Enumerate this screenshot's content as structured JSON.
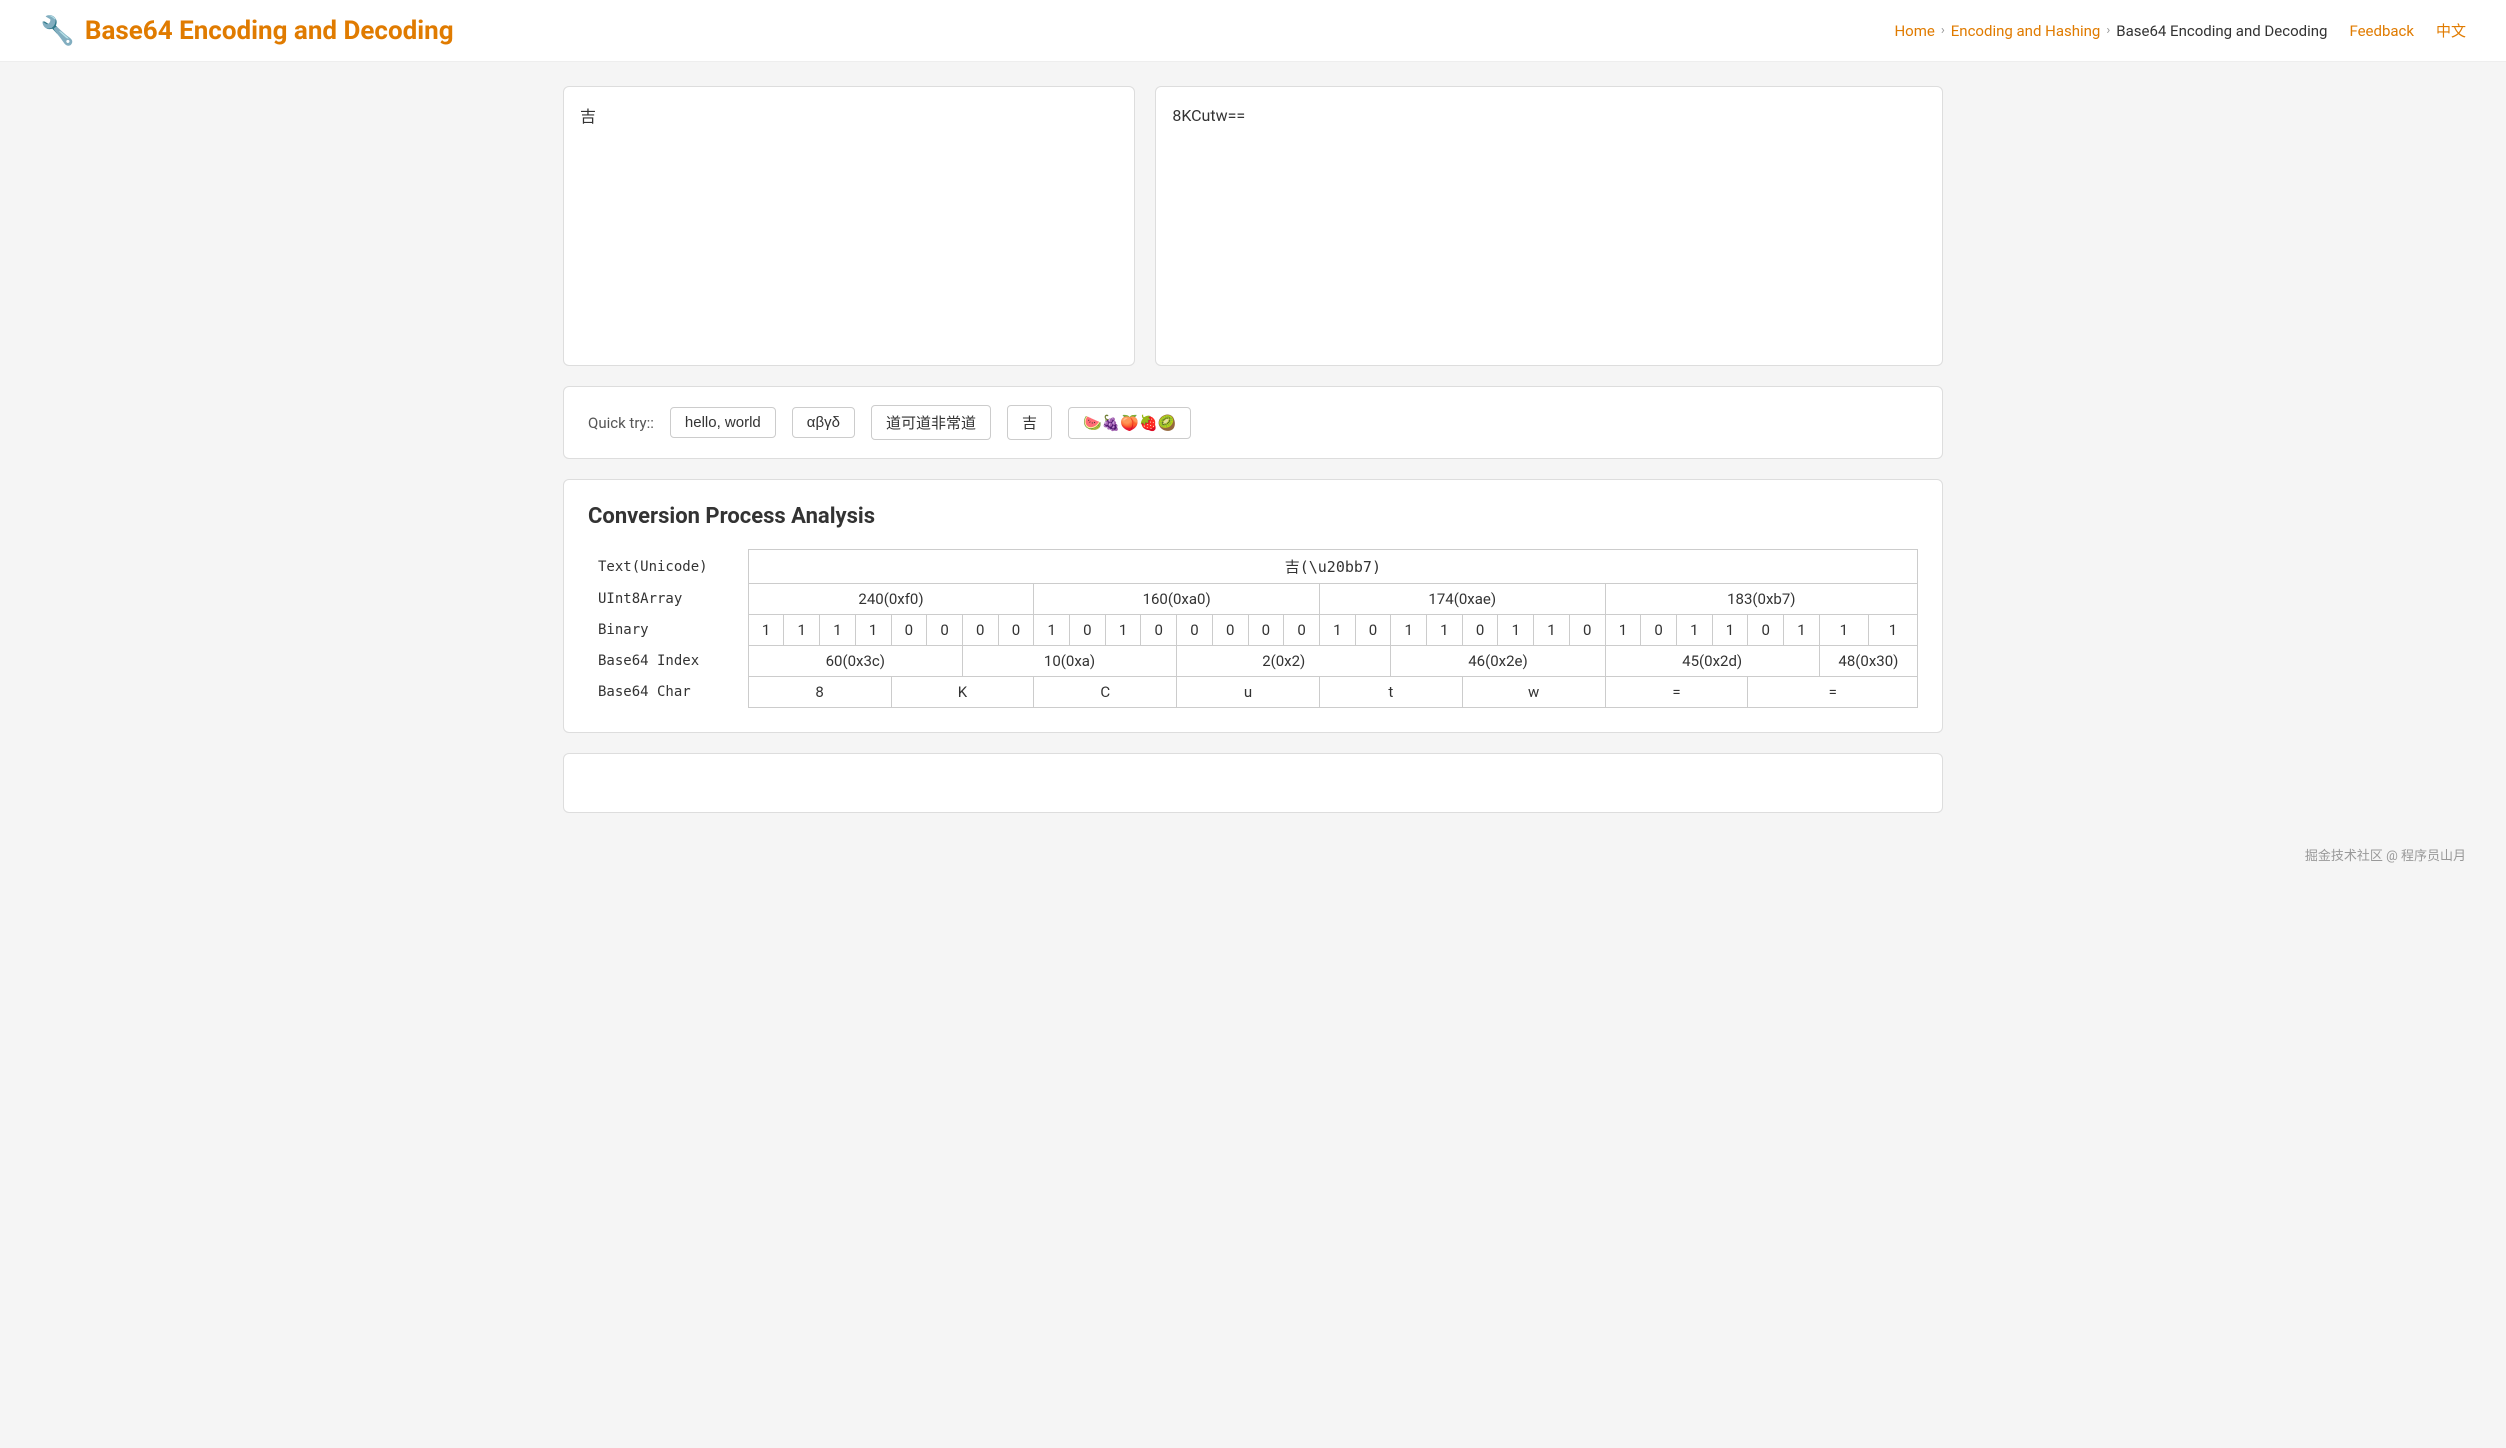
{
  "header": {
    "logo_icon": "🔧",
    "title": "Base64 Encoding and Decoding",
    "nav": {
      "home": "Home",
      "encoding_hashing": "Encoding and Hashing",
      "current": "Base64 Encoding and Decoding",
      "feedback": "Feedback",
      "lang": "中文"
    }
  },
  "left_panel": {
    "value": "吉"
  },
  "right_panel": {
    "value": "8KCutw=="
  },
  "quick_try": {
    "label": "Quick try::",
    "buttons": [
      {
        "label": "hello, world"
      },
      {
        "label": "αβγδ"
      },
      {
        "label": "道可道非常道"
      },
      {
        "label": "吉"
      },
      {
        "label": "🍉🍇🍑🍓🥝"
      }
    ]
  },
  "analysis": {
    "title": "Conversion Process Analysis",
    "rows": {
      "text_unicode": {
        "label": "Text(Unicode)",
        "cells": [
          "吉(\\u20bb7)"
        ]
      },
      "uint8array": {
        "label": "UInt8Array",
        "cells": [
          "240(0xf0)",
          "160(0xa0)",
          "174(0xae)",
          "183(0xb7)"
        ]
      },
      "binary": {
        "label": "Binary",
        "cells": [
          "1",
          "1",
          "1",
          "1",
          "0",
          "0",
          "0",
          "0",
          "1",
          "0",
          "1",
          "0",
          "0",
          "0",
          "0",
          "0",
          "1",
          "0",
          "1",
          "1",
          "0",
          "1",
          "1",
          "0",
          "1",
          "0",
          "1",
          "1",
          "0",
          "1",
          "1",
          "1"
        ]
      },
      "base64_index": {
        "label": "Base64 Index",
        "cells": [
          "60(0x3c)",
          "10(0xa)",
          "2(0x2)",
          "46(0x2e)",
          "45(0x2d)",
          "48(0x30)"
        ]
      },
      "base64_char": {
        "label": "Base64 Char",
        "cells": [
          "8",
          "K",
          "C",
          "u",
          "t",
          "w",
          "=",
          "="
        ]
      }
    }
  },
  "footer": {
    "text": "掘金技术社区 @ 程序员山月"
  }
}
